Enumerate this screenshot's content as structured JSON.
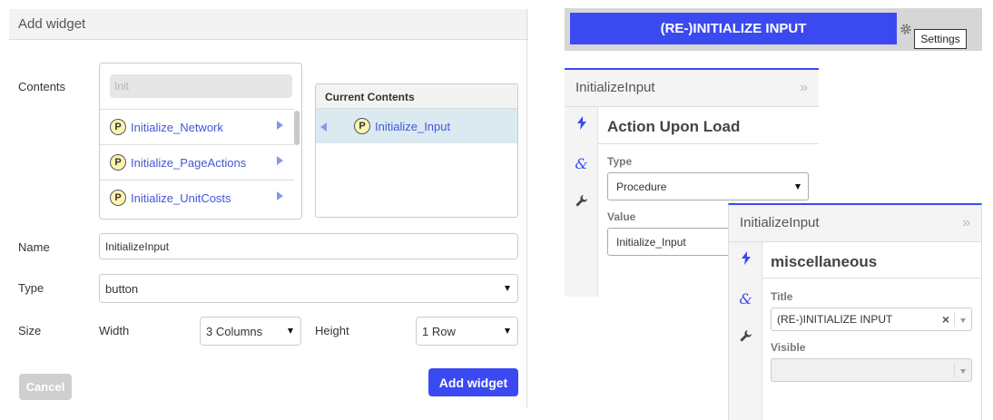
{
  "add_widget": {
    "title": "Add widget",
    "contents_label": "Contents",
    "search_placeholder": "Init",
    "contents_items": [
      "Initialize_Network",
      "Initialize_PageActions",
      "Initialize_UnitCosts"
    ],
    "badge_letter": "P",
    "current_contents_title": "Current Contents",
    "current_items": [
      "Initialize_Input"
    ],
    "name_label": "Name",
    "name_value": "InitializeInput",
    "type_label": "Type",
    "type_value": "button",
    "size_label": "Size",
    "width_label": "Width",
    "width_value": "3 Columns",
    "height_label": "Height",
    "height_value": "1 Row",
    "cancel_label": "Cancel",
    "add_label": "Add widget"
  },
  "preview": {
    "button_label": "(RE-)INITIALIZE INPUT",
    "tooltip": "Settings"
  },
  "panel1": {
    "title": "InitializeInput",
    "chevron": "»",
    "section_title": "Action Upon Load",
    "type_label": "Type",
    "type_value": "Procedure",
    "value_label": "Value",
    "value_value": "Initialize_Input"
  },
  "panel2": {
    "title": "InitializeInput",
    "chevron": "»",
    "section_title": "miscellaneous",
    "title_label": "Title",
    "title_value": "(RE-)INITIALIZE INPUT",
    "clear_glyph": "×",
    "visible_label": "Visible",
    "visible_value": ""
  },
  "colors": {
    "accent": "#3b49f0",
    "link": "#4457d6",
    "selected_row": "#dbe9f1"
  }
}
